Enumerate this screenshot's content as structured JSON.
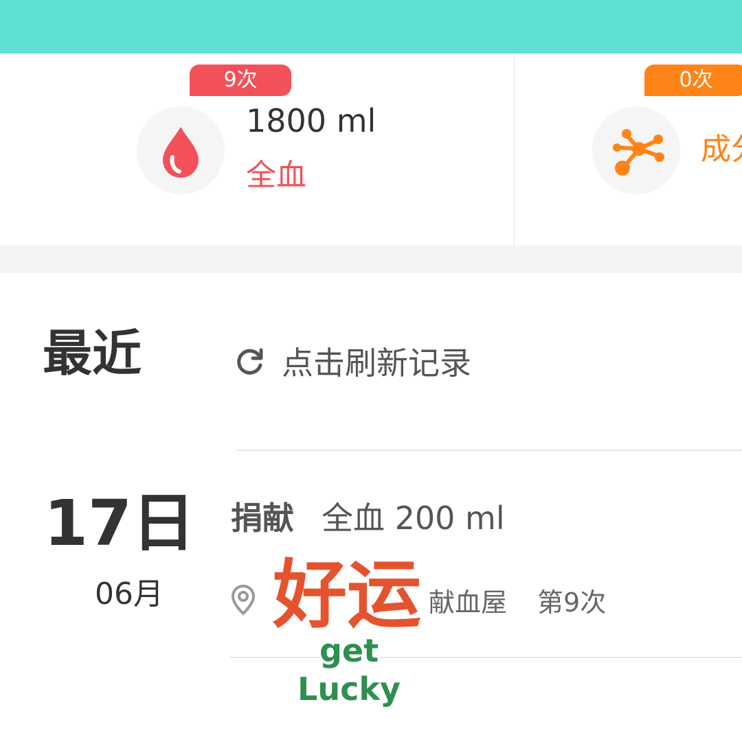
{
  "stats": {
    "whole_blood": {
      "badge": "9次",
      "volume": "1800 ml",
      "type": "全血",
      "color": "#f2515a",
      "icon": "blood-drop-icon"
    },
    "component": {
      "badge": "0次",
      "type": "成分",
      "color": "#ff8418",
      "icon": "molecule-icon"
    }
  },
  "recent": {
    "title": "最近",
    "refresh_label": "点击刷新记录",
    "refresh_icon": "refresh-icon"
  },
  "records": [
    {
      "day": "17日",
      "month": "06月",
      "action": "捐献",
      "detail": "全血 200 ml",
      "location": "献血屋",
      "count": "第9次",
      "location_icon": "location-pin-icon"
    }
  ],
  "sticker": {
    "cn": "好运",
    "en": "get Lucky"
  },
  "colors": {
    "topbar": "#5ee0d3",
    "accent_red": "#f2515a",
    "accent_orange": "#ff8418"
  }
}
